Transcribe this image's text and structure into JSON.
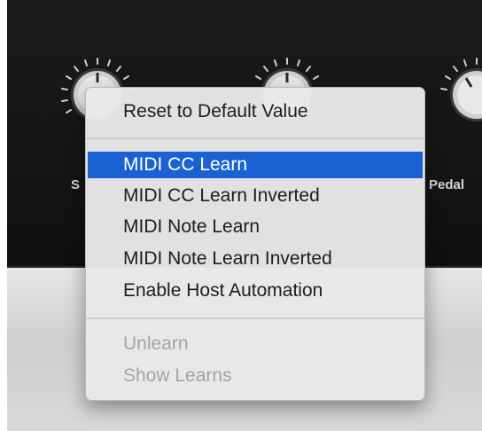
{
  "panel": {
    "labels": {
      "left_partial": "S",
      "right_partial": "Pedal"
    }
  },
  "context_menu": {
    "items": [
      {
        "label": "Reset to Default Value",
        "state": "normal"
      },
      {
        "label": "MIDI CC Learn",
        "state": "highlighted"
      },
      {
        "label": "MIDI CC Learn Inverted",
        "state": "normal"
      },
      {
        "label": "MIDI Note Learn",
        "state": "normal"
      },
      {
        "label": "MIDI Note Learn Inverted",
        "state": "normal"
      },
      {
        "label": "Enable Host Automation",
        "state": "normal"
      },
      {
        "label": "Unlearn",
        "state": "disabled"
      },
      {
        "label": "Show Learns",
        "state": "disabled"
      }
    ]
  },
  "colors": {
    "highlight": "#1a62d1",
    "panel": "#161617",
    "menu_bg": "#e8e8e8",
    "disabled_text": "#a4a4a4"
  }
}
